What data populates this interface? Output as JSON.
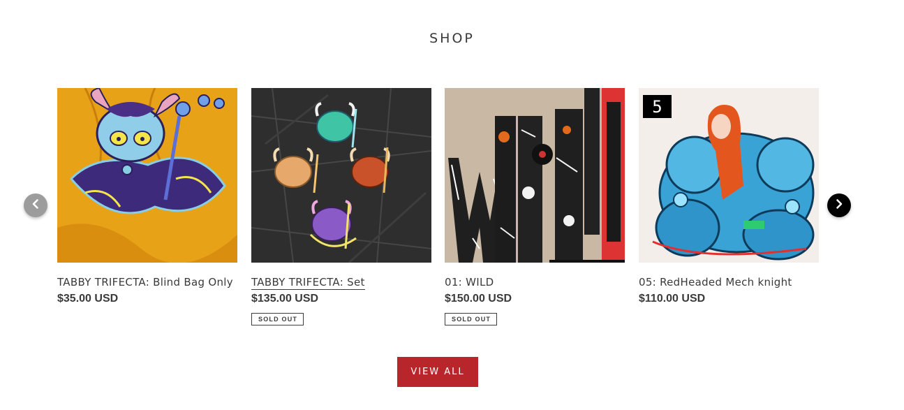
{
  "shop": {
    "title": "SHOP",
    "view_all_label": "VIEW ALL"
  },
  "carousel": {
    "prev_icon": "chevron-left-icon",
    "next_icon": "chevron-right-icon"
  },
  "products": [
    {
      "title": "TABBY TRIFECTA: Blind Bag Only",
      "price": "$35.00 USD",
      "badge": ""
    },
    {
      "title": "TABBY TRIFECTA: Set",
      "price": "$135.00 USD",
      "badge": "SOLD OUT"
    },
    {
      "title": "01: WILD",
      "price": "$150.00 USD",
      "badge": "SOLD OUT"
    },
    {
      "title": "05: RedHeaded Mech knight",
      "price": "$110.00 USD",
      "badge": "",
      "image_label": "5"
    }
  ],
  "colors": {
    "accent": "#b8262b",
    "text": "#3a3a3a",
    "arrow_prev": "#9c9c9c",
    "arrow_next": "#000000"
  }
}
